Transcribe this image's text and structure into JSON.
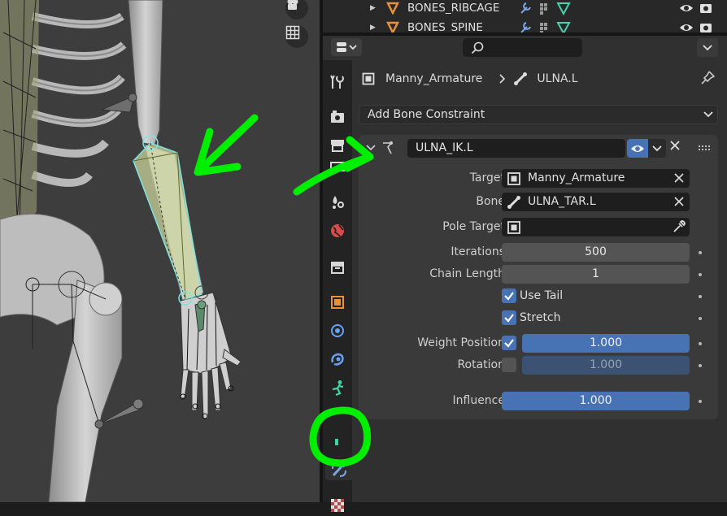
{
  "outliner": {
    "rows": [
      {
        "name": "BONES_RIBCAGE"
      },
      {
        "name": "BONES_SPINE"
      }
    ]
  },
  "properties": {
    "breadcrumb": {
      "object": "Manny_Armature",
      "bone": "ULNA.L"
    },
    "add_constraint_label": "Add Bone Constraint",
    "constraint": {
      "name": "ULNA_IK.L",
      "fields": {
        "target": {
          "label": "Target",
          "value": "Manny_Armature"
        },
        "bone": {
          "label": "Bone",
          "value": "ULNA_TAR.L"
        },
        "pole_target": {
          "label": "Pole Target",
          "value": ""
        },
        "iterations": {
          "label": "Iterations",
          "value": "500"
        },
        "chain_length": {
          "label": "Chain Length",
          "value": "1"
        },
        "use_tail": {
          "label": "Use Tail",
          "checked": true
        },
        "stretch": {
          "label": "Stretch",
          "checked": true
        },
        "weight_position": {
          "label": "Weight Position",
          "checked": true,
          "value": "1.000"
        },
        "rotation": {
          "label": "Rotation",
          "checked": false,
          "value": "1.000"
        },
        "influence": {
          "label": "Influence",
          "value": "1.000"
        }
      }
    },
    "tabs": [
      "tool-tab",
      "render-tab",
      "output-tab",
      "view-layer-tab",
      "scene-tab",
      "world-tab",
      "collection-tab",
      "object-tab",
      "modifiers-tab",
      "particles-tab",
      "physics-tab",
      "object-data-tab",
      "bone-tab",
      "bone-constraint-tab",
      "texture-tab"
    ],
    "active_tab": "bone-constraint-tab"
  },
  "colors": {
    "accent": "#4772b3",
    "annotation": "#00ee00",
    "armature_icon": "#e8903a",
    "bone_highlight": "#c9d39a"
  }
}
